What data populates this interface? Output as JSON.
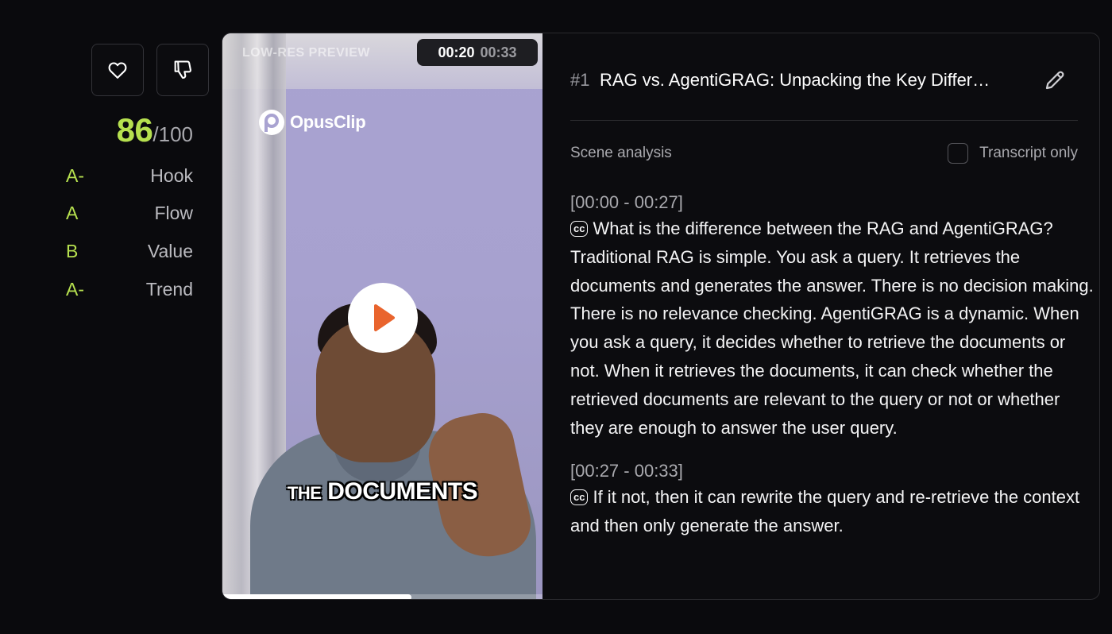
{
  "sidebar": {
    "like_icon": "heart-icon",
    "dislike_icon": "thumbs-down-icon",
    "score": "86",
    "score_total": "/100",
    "grades": [
      {
        "grade": "A-",
        "label": "Hook"
      },
      {
        "grade": "A",
        "label": "Flow"
      },
      {
        "grade": "B",
        "label": "Value"
      },
      {
        "grade": "A-",
        "label": "Trend"
      }
    ],
    "accent_color": "#b6e04f"
  },
  "video": {
    "watermark": "LOW-RES PREVIEW",
    "current_time": "00:20",
    "total_time": "00:33",
    "brand": "OpusClip",
    "caption_small": "THE",
    "caption_large": "DOCUMENTS",
    "progress": 0.59,
    "play_icon": "play-icon"
  },
  "clip": {
    "number": "#1",
    "title": "RAG vs. AgentiGRAG: Unpacking the Key Differ…",
    "edit_icon": "pencil-icon"
  },
  "analysis": {
    "scene_label": "Scene analysis",
    "transcript_toggle_label": "Transcript only",
    "segments": [
      {
        "time": "[00:00 - 00:27]",
        "text": "What is the difference between the RAG and AgentiGRAG? Traditional RAG is simple. You ask a query. It retrieves the documents and generates the answer. There is no decision making. There is no relevance checking. AgentiGRAG is a dynamic. When you ask a query, it decides whether to retrieve the documents or not. When it retrieves the documents, it can check whether the retrieved documents are relevant to the query or not or whether they are enough to answer the user query."
      },
      {
        "time": "[00:27 - 00:33]",
        "text": "If it not, then it can rewrite the query and re-retrieve the context and then only generate the answer."
      }
    ],
    "cc_label": "cc"
  }
}
